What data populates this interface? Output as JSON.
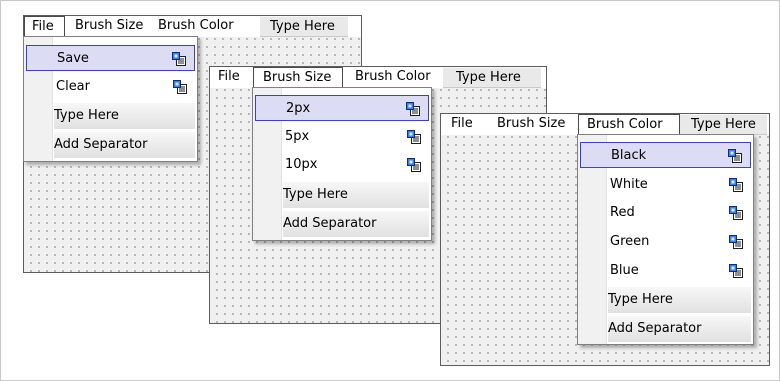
{
  "forms": [
    {
      "menubar": {
        "file": "File",
        "brush_size": "Brush Size",
        "brush_color": "Brush Color",
        "type_here": "Type Here"
      },
      "dropdown": {
        "items": [
          {
            "label": "Save"
          },
          {
            "label": "Clear"
          }
        ],
        "highlighted": "Save",
        "type_here": "Type Here",
        "add_separator": "Add Separator"
      }
    },
    {
      "menubar": {
        "file": "File",
        "brush_size": "Brush Size",
        "brush_color": "Brush Color",
        "type_here": "Type Here"
      },
      "dropdown": {
        "items": [
          {
            "label": "2px"
          },
          {
            "label": "5px"
          },
          {
            "label": "10px"
          }
        ],
        "highlighted": "2px",
        "type_here": "Type Here",
        "add_separator": "Add Separator"
      }
    },
    {
      "menubar": {
        "file": "File",
        "brush_size": "Brush Size",
        "brush_color": "Brush Color",
        "type_here": "Type Here"
      },
      "dropdown": {
        "items": [
          {
            "label": "Black"
          },
          {
            "label": "White"
          },
          {
            "label": "Red"
          },
          {
            "label": "Green"
          },
          {
            "label": "Blue"
          }
        ],
        "highlighted": "Black",
        "type_here": "Type Here",
        "add_separator": "Add Separator"
      }
    }
  ],
  "colors": {
    "highlight_fill": "#dcdcf5",
    "highlight_border": "#3b40c7",
    "designer_grid": "#f0f0f0"
  },
  "icons": {
    "menu_item": "menu-item-properties-icon"
  }
}
